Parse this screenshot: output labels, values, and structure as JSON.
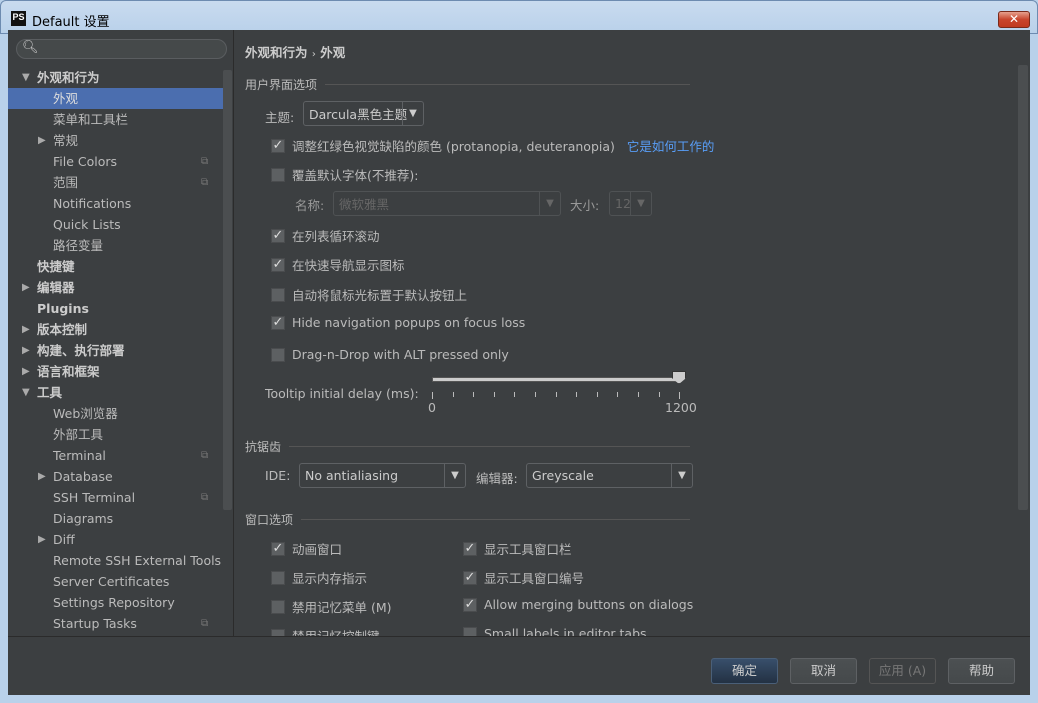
{
  "window": {
    "title": "Default 设置",
    "logo": "PS"
  },
  "sidebar": {
    "search_placeholder": "",
    "items": [
      {
        "label": "外观和行为",
        "level": 0,
        "arrow": "down",
        "bold": true
      },
      {
        "label": "外观",
        "level": 1,
        "selected": true
      },
      {
        "label": "菜单和工具栏",
        "level": 1
      },
      {
        "label": "常规",
        "level": 1,
        "arrow": "right"
      },
      {
        "label": "File Colors",
        "level": 1,
        "copy": true
      },
      {
        "label": "范围",
        "level": 1,
        "copy": true
      },
      {
        "label": "Notifications",
        "level": 1
      },
      {
        "label": "Quick Lists",
        "level": 1
      },
      {
        "label": "路径变量",
        "level": 1
      },
      {
        "label": "快捷键",
        "level": 0,
        "bold": true
      },
      {
        "label": "编辑器",
        "level": 0,
        "arrow": "right",
        "bold": true
      },
      {
        "label": "Plugins",
        "level": 0,
        "bold": true
      },
      {
        "label": "版本控制",
        "level": 0,
        "arrow": "right",
        "bold": true
      },
      {
        "label": "构建、执行部署",
        "level": 0,
        "arrow": "right",
        "bold": true
      },
      {
        "label": "语言和框架",
        "level": 0,
        "arrow": "right",
        "bold": true
      },
      {
        "label": "工具",
        "level": 0,
        "arrow": "down",
        "bold": true
      },
      {
        "label": "Web浏览器",
        "level": 1
      },
      {
        "label": "外部工具",
        "level": 1
      },
      {
        "label": "Terminal",
        "level": 1,
        "copy": true
      },
      {
        "label": "Database",
        "level": 1,
        "arrow": "right"
      },
      {
        "label": "SSH Terminal",
        "level": 1,
        "copy": true
      },
      {
        "label": "Diagrams",
        "level": 1
      },
      {
        "label": "Diff",
        "level": 1,
        "arrow": "right"
      },
      {
        "label": "Remote SSH External Tools",
        "level": 1
      },
      {
        "label": "Server Certificates",
        "level": 1
      },
      {
        "label": "Settings Repository",
        "level": 1
      },
      {
        "label": "Startup Tasks",
        "level": 1,
        "copy": true
      }
    ]
  },
  "main": {
    "breadcrumb": {
      "parent": "外观和行为",
      "sep": "›",
      "current": "外观"
    },
    "ui_section": "用户界面选项",
    "theme_label": "主题:",
    "theme_value": "Darcula黑色主题",
    "adjust_colors": {
      "label": "调整红绿色视觉缺陷的颜色 (protanopia, deuteranopia)",
      "checked": true,
      "link": "它是如何工作的"
    },
    "override_font": {
      "label": "覆盖默认字体(不推荐):",
      "checked": false
    },
    "font_name_label": "名称:",
    "font_name_value": "微软雅黑",
    "font_size_label": "大小:",
    "font_size_value": "12",
    "cyclic_scroll": {
      "label": "在列表循环滚动",
      "checked": true
    },
    "show_icons_nav": {
      "label": "在快速导航显示图标",
      "checked": true
    },
    "move_mouse": {
      "label": "自动将鼠标光标置于默认按钮上",
      "checked": false
    },
    "hide_popups": {
      "label": "Hide navigation popups on focus loss",
      "checked": true
    },
    "dnd_alt": {
      "label": "Drag-n-Drop with ALT pressed only",
      "checked": false
    },
    "tooltip": {
      "label": "Tooltip initial delay (ms):",
      "min": "0",
      "max": "1200",
      "value": 1200
    },
    "aa_section": "抗锯齿",
    "ide_label": "IDE:",
    "ide_value": "No antialiasing",
    "editor_label": "编辑器:",
    "editor_value": "Greyscale",
    "window_section": "窗口选项",
    "window_options": [
      {
        "label": "动画窗口",
        "checked": true
      },
      {
        "label": "显示工具窗口栏",
        "checked": true
      },
      {
        "label": "显示内存指示",
        "checked": false
      },
      {
        "label": "显示工具窗口编号",
        "checked": true
      },
      {
        "label": "禁用记忆菜单 (M)",
        "checked": false
      },
      {
        "label": "Allow merging buttons on dialogs",
        "checked": true
      },
      {
        "label": "禁用记忆控制键",
        "checked": false
      },
      {
        "label": "Small labels in editor tabs",
        "checked": false
      }
    ]
  },
  "footer": {
    "ok": "确定",
    "cancel": "取消",
    "apply": "应用 (A)",
    "help": "帮助"
  }
}
